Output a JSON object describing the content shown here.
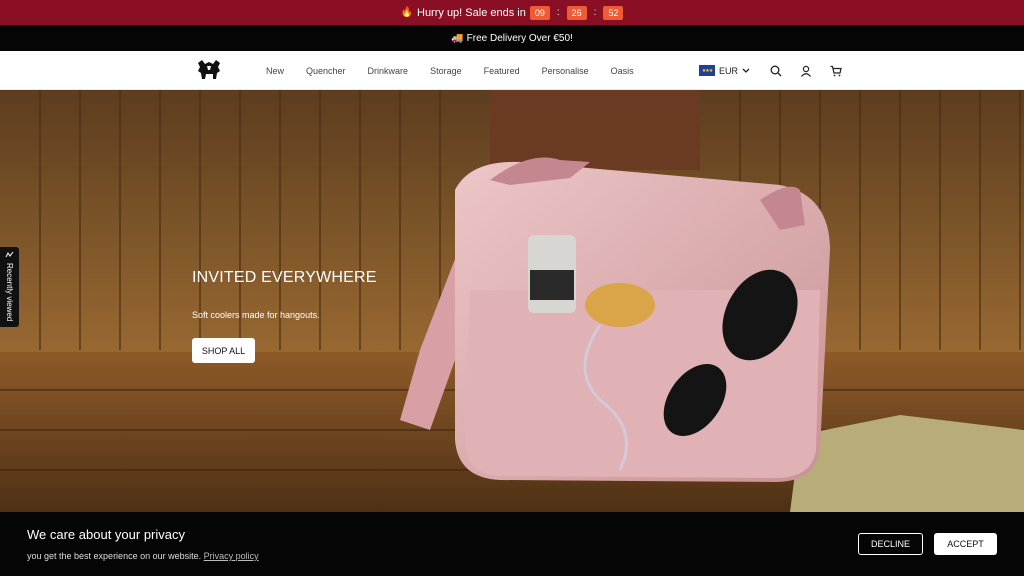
{
  "sale_bar": {
    "emoji": "🔥",
    "text": "Hurry up! Sale ends in",
    "hours": "09",
    "minutes": "26",
    "seconds": "52",
    "separator": ":"
  },
  "delivery_bar": {
    "emoji": "🚚",
    "text": "Free Delivery Over €50!"
  },
  "nav": {
    "items": [
      "New",
      "Quencher",
      "Drinkware",
      "Storage",
      "Featured",
      "Personalise",
      "Oasis"
    ]
  },
  "header": {
    "currency": "EUR"
  },
  "hero": {
    "title": "INVITED EVERYWHERE",
    "subtitle": "Soft coolers made for hangouts.",
    "cta": "SHOP ALL"
  },
  "recent_tab": {
    "label": "Recently viewed"
  },
  "privacy": {
    "title": "We care about your privacy",
    "text": "you get the best experience on our website.",
    "link": "Privacy policy",
    "decline": "DECLINE",
    "accept": "ACCEPT"
  },
  "colors": {
    "sale_bar_bg": "#8a0f25",
    "countdown_bg": "#ef5b35",
    "delivery_bar_bg": "#050505",
    "privacy_bg": "#050505"
  }
}
